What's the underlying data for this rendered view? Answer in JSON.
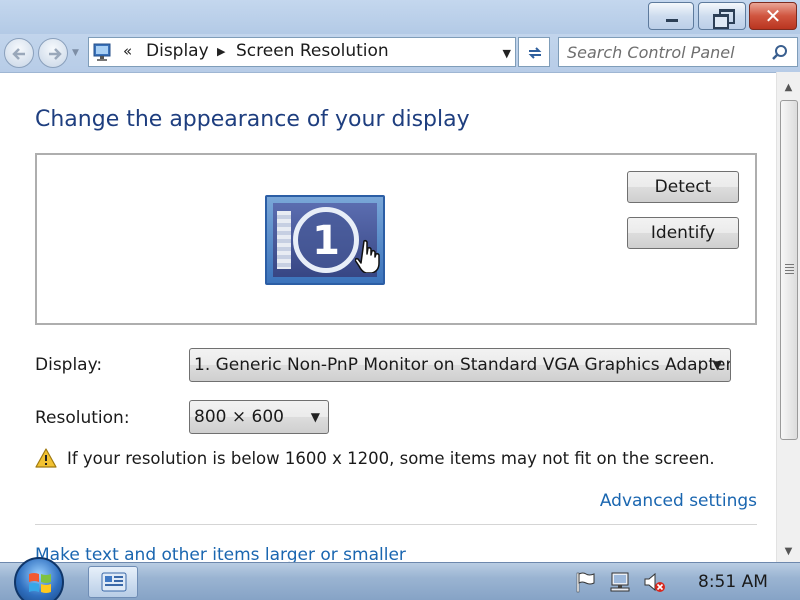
{
  "navigation": {
    "breadcrumb_overflow": "«",
    "breadcrumbs": [
      "Display",
      "Screen Resolution"
    ]
  },
  "search": {
    "placeholder": "Search Control Panel"
  },
  "main": {
    "title": "Change the appearance of your display",
    "monitor_number": "1",
    "detect_label": "Detect",
    "identify_label": "Identify",
    "display_label": "Display:",
    "display_value": "1. Generic Non-PnP Monitor on Standard VGA Graphics Adapter",
    "resolution_label": "Resolution:",
    "resolution_value": "800 × 600",
    "warning_text": "If your resolution is below 1600 x 1200, some items may not fit on the screen.",
    "advanced_link": "Advanced settings",
    "textsize_link": "Make text and other items larger or smaller"
  },
  "taskbar": {
    "clock": "8:51 AM"
  },
  "colors": {
    "title": "#1e3e7f",
    "link": "#1a66b0",
    "close_button": "#c7442e"
  }
}
